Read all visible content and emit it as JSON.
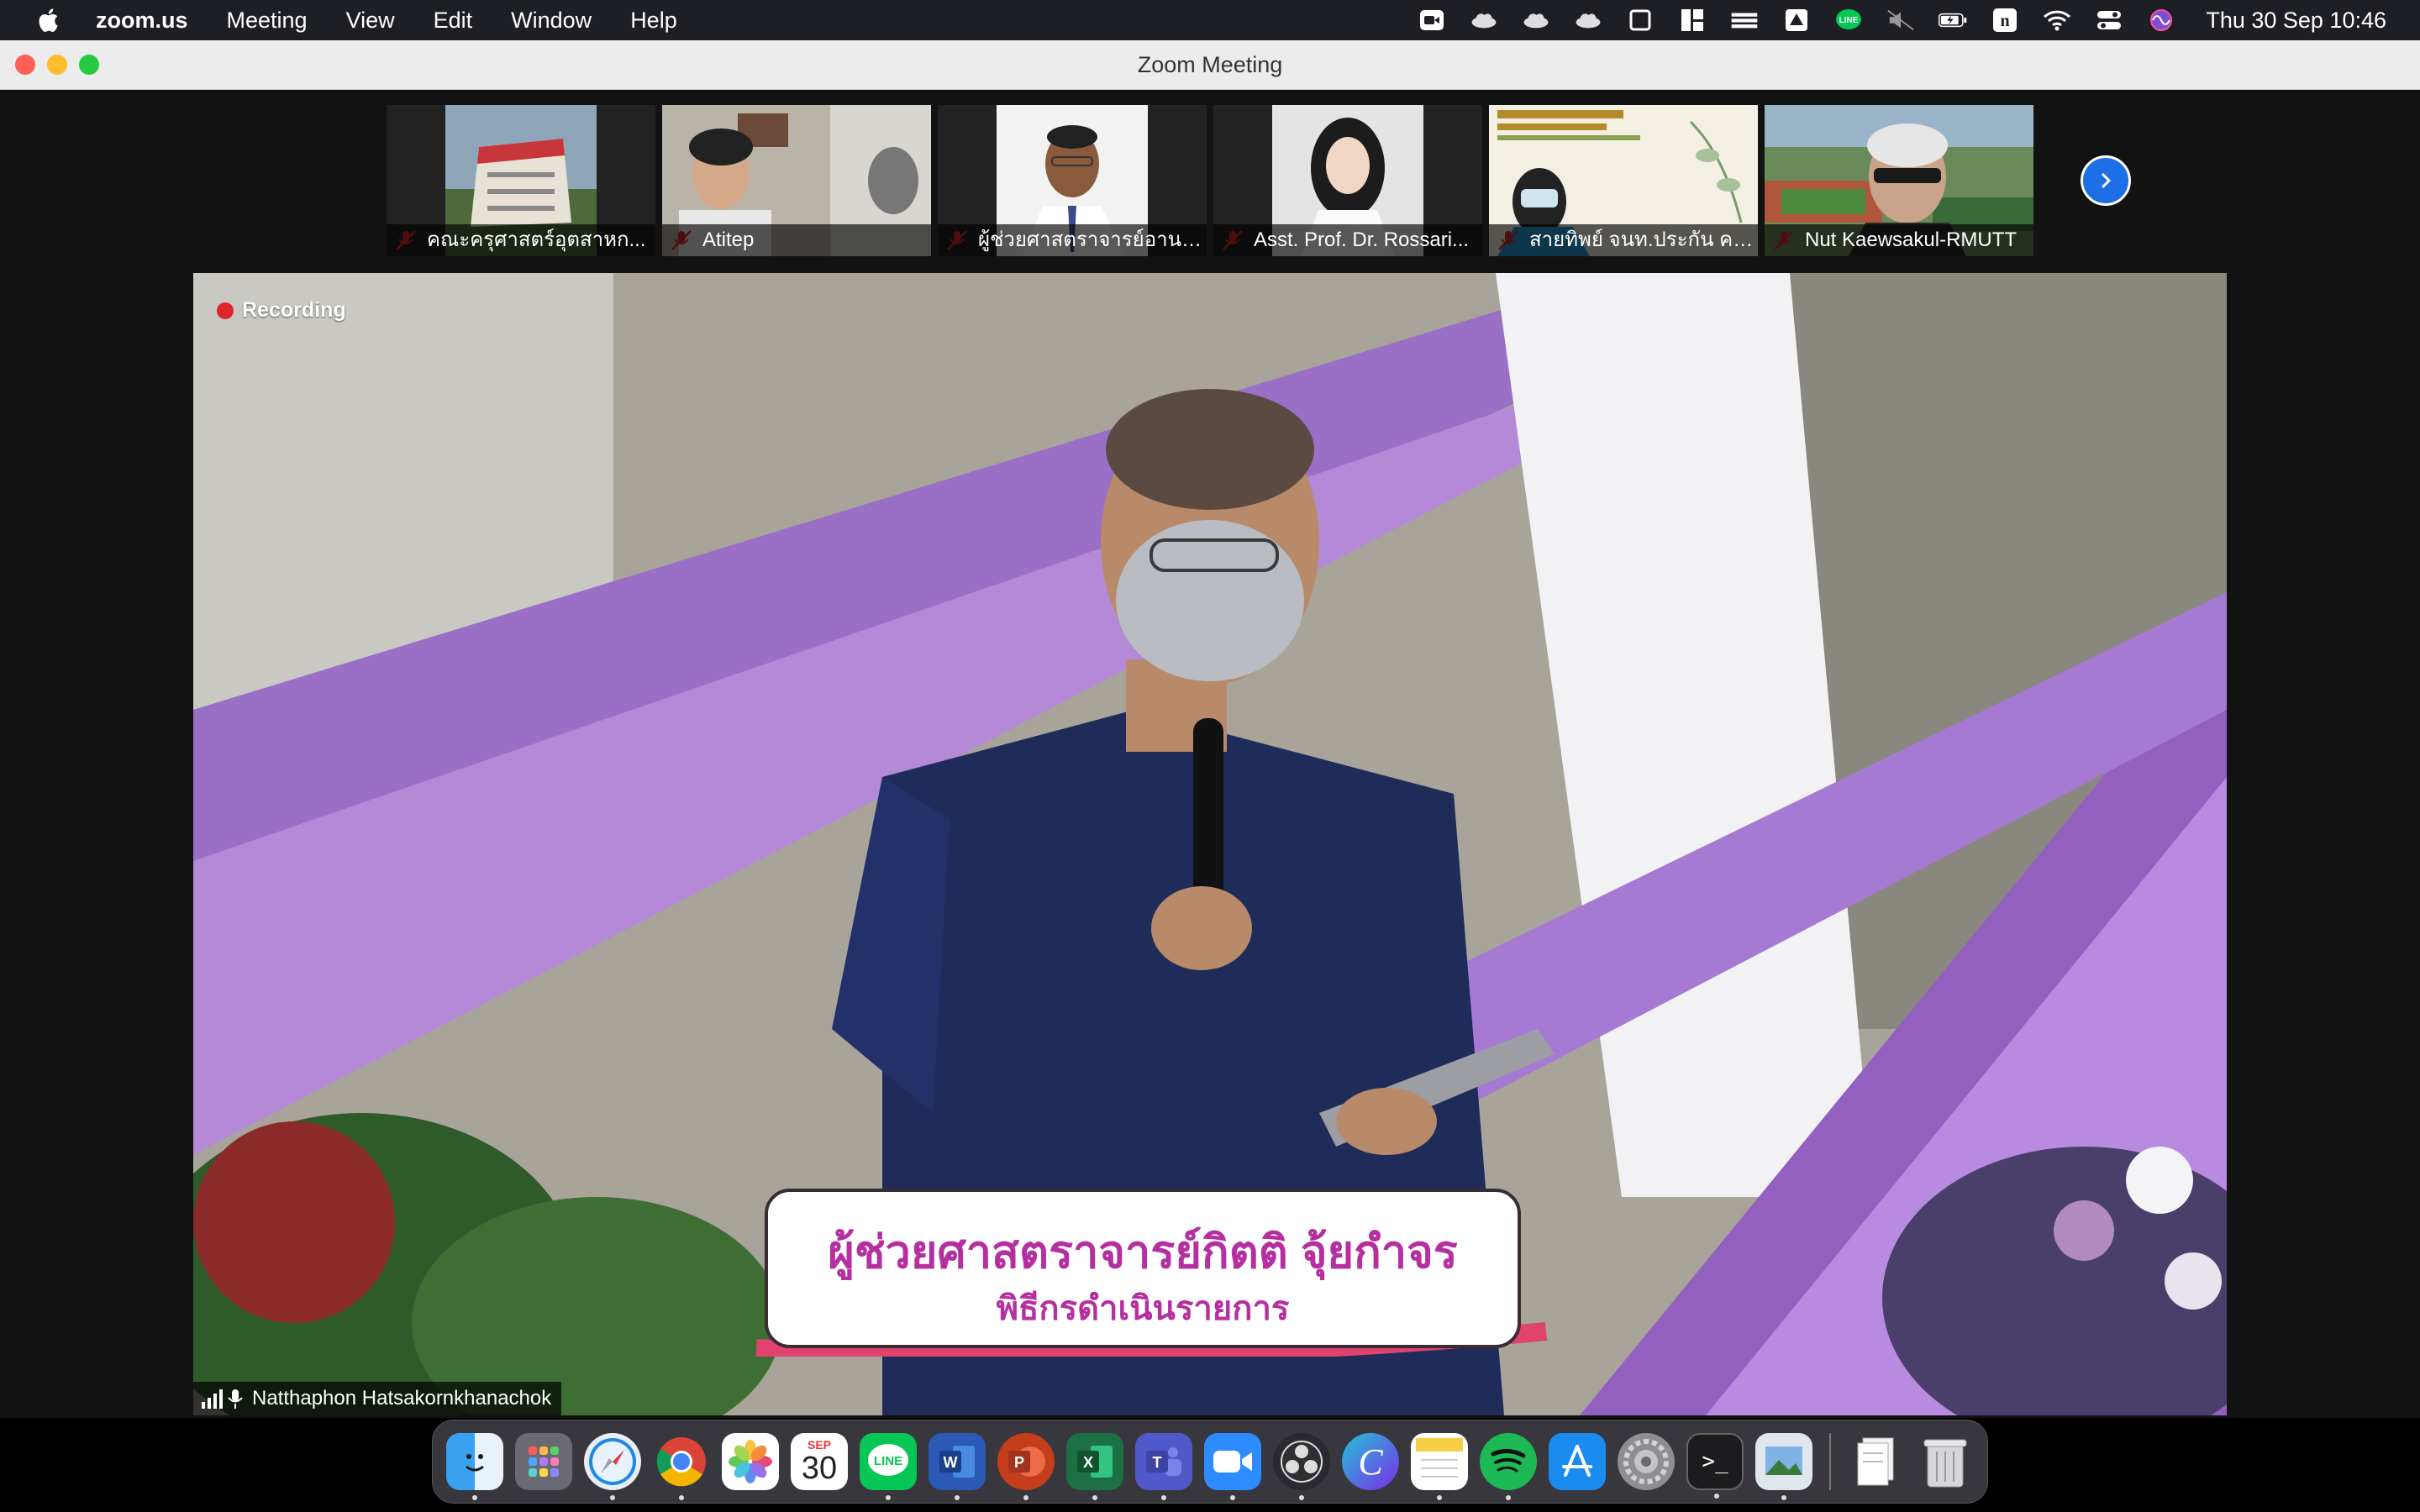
{
  "menubar": {
    "app_name": "zoom.us",
    "menus": [
      "Meeting",
      "View",
      "Edit",
      "Window",
      "Help"
    ],
    "clock": "Thu 30 Sep  10:46"
  },
  "window": {
    "title": "Zoom Meeting"
  },
  "thumbnails": [
    {
      "name": "คณะครุศาสตร์อุตสาหก...",
      "muted": true
    },
    {
      "name": "Atitep",
      "muted": true
    },
    {
      "name": "ผู้ช่วยศาสตราจารย์อานน...",
      "muted": true
    },
    {
      "name": "Asst. Prof. Dr. Rossari...",
      "muted": true
    },
    {
      "name": "สายทิพย์ จนท.ประกัน คอ...",
      "muted": true
    },
    {
      "name": "Nut Kaewsakul-RMUTT",
      "muted": true
    }
  ],
  "main_video": {
    "recording_label": "Recording",
    "speaker_name": "Natthaphon Hatsakornkhanachok",
    "lower_third_title": "ผู้ช่วยศาสตราจารย์กิตติ จุ้ยกำจร",
    "lower_third_subtitle": "พิธีกรดำเนินรายการ"
  },
  "dock": {
    "calendar_month": "SEP",
    "calendar_day": "30",
    "apps": [
      "finder",
      "launchpad",
      "safari",
      "chrome",
      "photos",
      "calendar",
      "line",
      "word",
      "powerpoint",
      "excel",
      "teams",
      "zoom",
      "obs",
      "canva",
      "notes",
      "spotify",
      "app-store",
      "system-preferences",
      "terminal",
      "preview",
      "downloads",
      "trash"
    ]
  },
  "colors": {
    "menubar_bg": "#1e1f24",
    "zoom_blue": "#1d6fe6",
    "recording_red": "#e0252b",
    "lower_third_text": "#b52fa0"
  }
}
